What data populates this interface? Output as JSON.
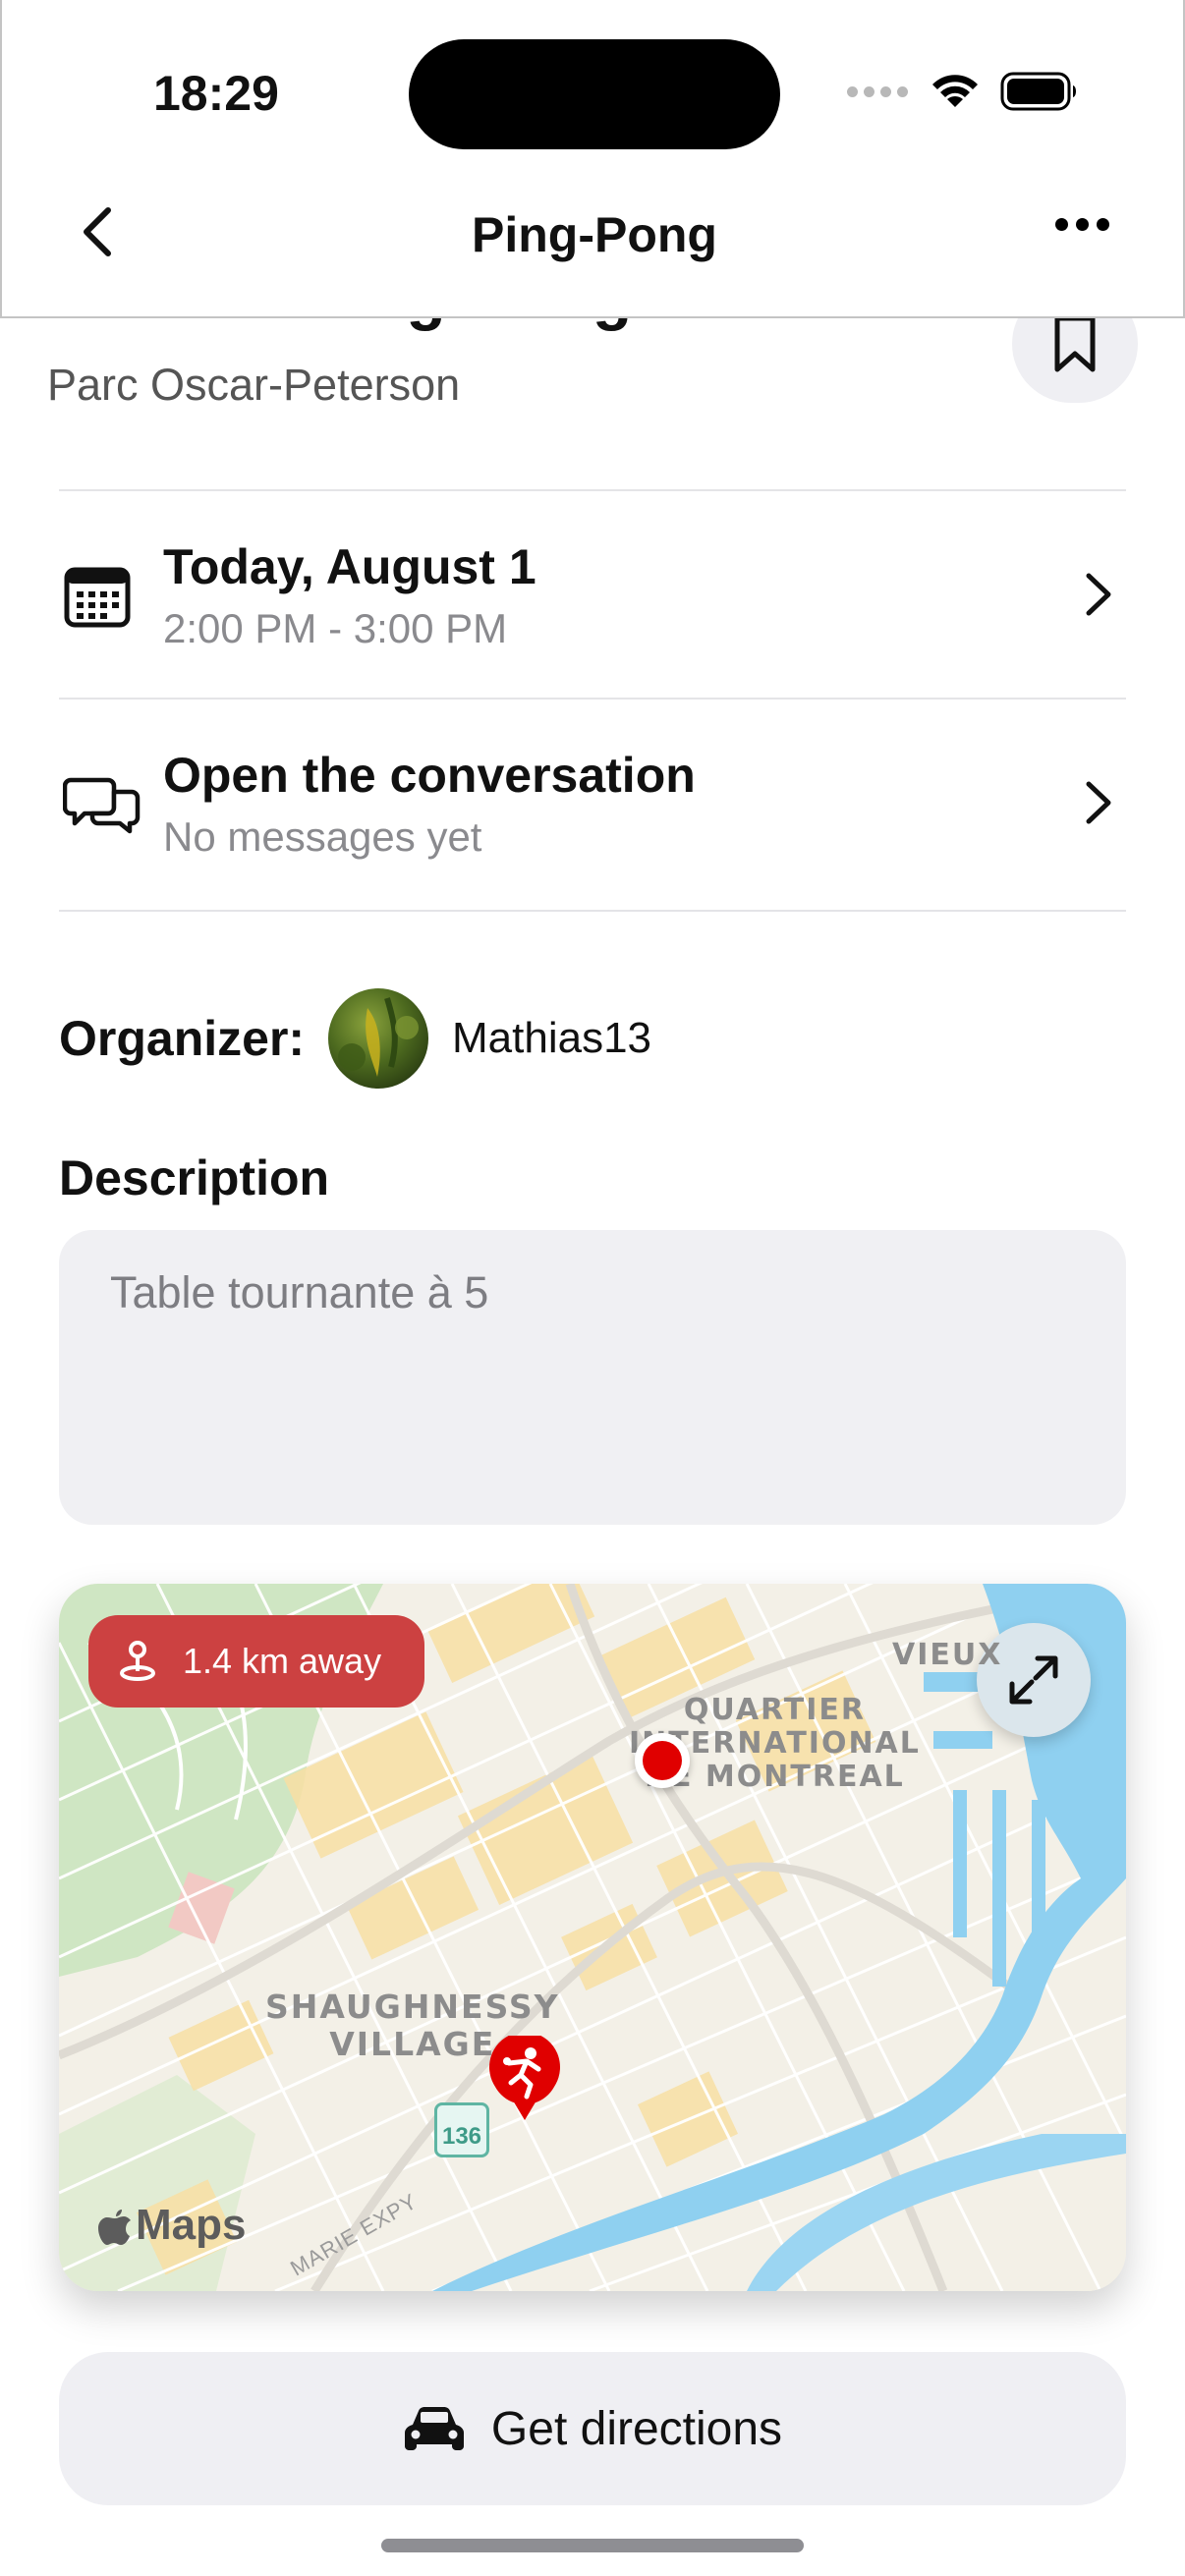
{
  "status_bar": {
    "time": "18:29"
  },
  "nav": {
    "title": "Ping-Pong"
  },
  "activity": {
    "title": "Activité Ping-Pong",
    "location": "Parc Oscar-Peterson"
  },
  "date_row": {
    "title": "Today, August 1",
    "subtitle": "2:00 PM - 3:00 PM"
  },
  "conversation_row": {
    "title": "Open the conversation",
    "subtitle": "No messages yet"
  },
  "organizer": {
    "label": "Organizer:",
    "name": "Mathias13"
  },
  "description": {
    "label": "Description",
    "text": "Table tournante à 5"
  },
  "map": {
    "distance": "1.4 km away",
    "labels": {
      "vieux": "VIEUX",
      "quartier": "QUARTIER\nINTERNATIONAL\nDE MONTREAL",
      "shaughnessy": "SHAUGHNESSY\nVILLAGE"
    },
    "route_number": "136",
    "street": "MARIE EXPY",
    "attribution": "Maps",
    "colors": {
      "pin": "#e00000",
      "pill": "#cc4141",
      "water": "#8fd0f0"
    }
  },
  "directions": {
    "label": "Get directions"
  },
  "icons": [
    "back-chevron-icon",
    "more-icon",
    "bookmark-icon",
    "calendar-icon",
    "chat-icon",
    "chevron-right-icon",
    "distance-pin-icon",
    "expand-icon",
    "ping-pong-icon",
    "apple-icon",
    "car-icon"
  ]
}
